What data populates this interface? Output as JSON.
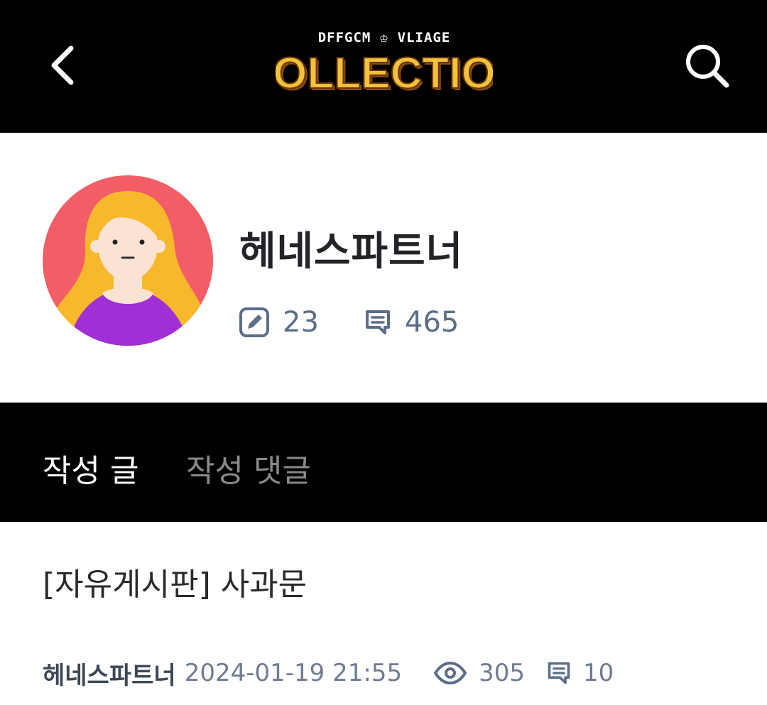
{
  "header": {
    "logo_subtitle": "DFFGCM ♔ VLIAGE",
    "logo_title": "COLLECTION",
    "logo_color": "#f2c23a",
    "back_icon": "chevron-left-icon",
    "search_icon": "search-icon"
  },
  "profile": {
    "nickname": "헤네스파트너",
    "post_count": "23",
    "comment_count": "465",
    "posts_icon": "edit-icon",
    "comments_icon": "comment-icon",
    "avatar_bg": "#f35d66"
  },
  "tabs": [
    {
      "label": "작성 글",
      "active": true
    },
    {
      "label": "작성 댓글",
      "active": false
    }
  ],
  "posts": [
    {
      "title": "[자유게시판] 사과문",
      "author": "헤네스파트너",
      "date": "2024-01-19 21:55",
      "views": "305",
      "comments": "10"
    }
  ]
}
